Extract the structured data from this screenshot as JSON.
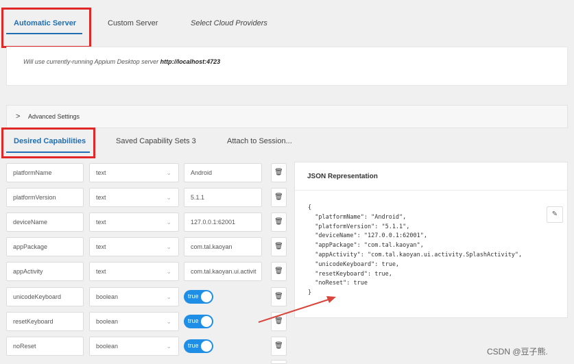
{
  "server_tabs": [
    {
      "label": "Automatic Server",
      "active": true
    },
    {
      "label": "Custom Server",
      "active": false
    },
    {
      "label": "Select Cloud Providers",
      "active": false
    }
  ],
  "server_message": {
    "prefix": "Will use currently-running Appium Desktop server ",
    "url": "http://localhost:4723"
  },
  "advanced_settings": {
    "chevron": ">",
    "label": "Advanced Settings"
  },
  "capability_tabs": [
    {
      "label": "Desired Capabilities",
      "active": true
    },
    {
      "label": "Saved Capability Sets 3",
      "active": false
    },
    {
      "label": "Attach to Session...",
      "active": false
    }
  ],
  "capabilities": [
    {
      "name": "platformName",
      "type": "text",
      "value": "Android"
    },
    {
      "name": "platformVersion",
      "type": "text",
      "value": "5.1.1"
    },
    {
      "name": "deviceName",
      "type": "text",
      "value": "127.0.0.1:62001"
    },
    {
      "name": "appPackage",
      "type": "text",
      "value": "com.tal.kaoyan"
    },
    {
      "name": "appActivity",
      "type": "text",
      "value": "com.tal.kaoyan.ui.activit"
    },
    {
      "name": "unicodeKeyboard",
      "type": "boolean",
      "value": "true"
    },
    {
      "name": "resetKeyboard",
      "type": "boolean",
      "value": "true"
    },
    {
      "name": "noReset",
      "type": "boolean",
      "value": "true"
    }
  ],
  "json_panel": {
    "title": "JSON Representation",
    "code": "{\n  \"platformName\": \"Android\",\n  \"platformVersion\": \"5.1.1\",\n  \"deviceName\": \"127.0.0.1:62001\",\n  \"appPackage\": \"com.tal.kaoyan\",\n  \"appActivity\": \"com.tal.kaoyan.ui.activity.SplashActivity\",\n  \"unicodeKeyboard\": true,\n  \"resetKeyboard\": true,\n  \"noReset\": true\n}"
  },
  "icons": {
    "trash": "trash-icon",
    "edit": "pencil-icon",
    "chevron_down": "chevron-down-icon",
    "chevron_right": "chevron-right-icon"
  },
  "watermark": "CSDN @豆子熊.",
  "colors": {
    "accent": "#1f6fb2",
    "toggle": "#1f8ee6",
    "annotation": "#e02828"
  }
}
